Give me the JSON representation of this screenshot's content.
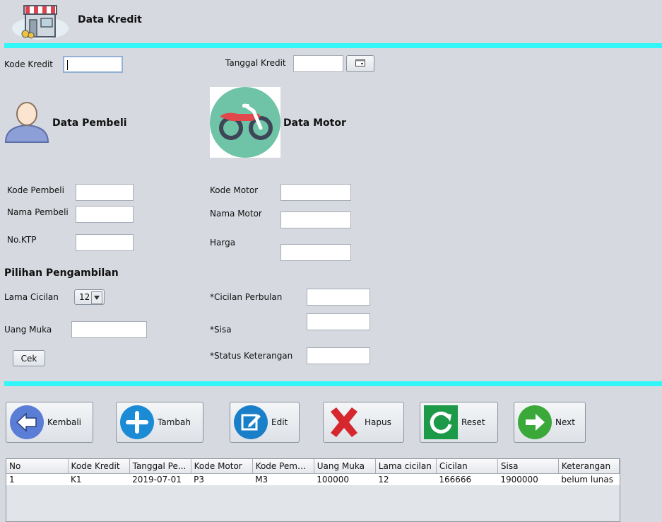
{
  "header": {
    "title": "Data Kredit",
    "icon": "store-icon"
  },
  "top_form": {
    "kode_kredit_label": "Kode Kredit",
    "kode_kredit_value": "",
    "tanggal_kredit_label": "Tanggal Kredit",
    "tanggal_kredit_value": ""
  },
  "pembeli": {
    "title": "Data Pembeli",
    "kode_label": "Kode Pembeli",
    "nama_label": "Nama Pembeli",
    "ktp_label": "No.KTP",
    "kode_value": "",
    "nama_value": "",
    "ktp_value": ""
  },
  "motor": {
    "title": "Data Motor",
    "kode_label": "Kode Motor",
    "nama_label": "Nama Motor",
    "harga_label": "Harga",
    "kode_value": "",
    "nama_value": "",
    "harga_value": ""
  },
  "pengambilan": {
    "title": "Pilihan Pengambilan",
    "lama_label": "Lama Cicilan",
    "lama_selected": "12",
    "uang_muka_label": "Uang Muka",
    "uang_muka_value": "",
    "cek_label": "Cek",
    "cicilan_label": "*Cicilan Perbulan",
    "sisa_label": "*Sisa",
    "status_label": "*Status Keterangan",
    "cicilan_value": "",
    "sisa_value": "",
    "status_value": ""
  },
  "actions": {
    "kembali": "Kembali",
    "tambah": "Tambah",
    "edit": "Edit",
    "hapus": "Hapus",
    "reset": "Reset",
    "next": "Next"
  },
  "table": {
    "headers": [
      "No",
      "Kode Kredit",
      "Tanggal Pe...",
      "Kode Motor",
      "Kode Pemb...",
      "Uang Muka",
      "Lama cicilan",
      "Cicilan",
      "Sisa",
      "Keterangan"
    ],
    "rows": [
      [
        "1",
        "K1",
        "2019-07-01",
        "P3",
        "M3",
        "100000",
        "12",
        "166666",
        "1900000",
        "belum lunas"
      ]
    ]
  },
  "colors": {
    "accent_bar": "#33f6f8",
    "background": "#d6d9df"
  }
}
